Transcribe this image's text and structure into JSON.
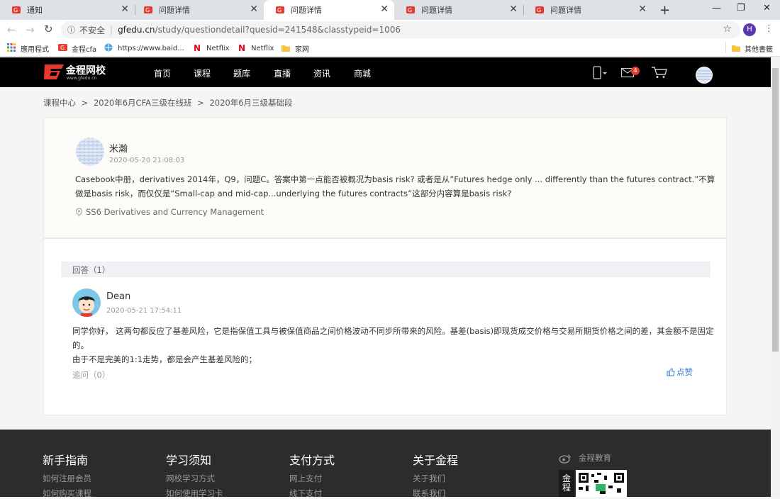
{
  "tabs": [
    {
      "label": "通知"
    },
    {
      "label": "问题详情"
    },
    {
      "label": "问题详情"
    },
    {
      "label": "问题详情"
    },
    {
      "label": "问题详情"
    }
  ],
  "toolbar": {
    "security": "不安全",
    "url_domain": "gfedu.cn",
    "url_path": "/study/questiondetail?quesid=241548&classtypeid=1006",
    "profile_initial": "H"
  },
  "bookmarks": {
    "items": [
      {
        "label": "應用程式"
      },
      {
        "label": "金程cfa"
      },
      {
        "label": "https://www.baid..."
      },
      {
        "label": "Netflix"
      },
      {
        "label": "Netflix"
      },
      {
        "label": "家网"
      }
    ],
    "other": "其他書籤"
  },
  "site": {
    "logo_text": "金程网校",
    "logo_sub": "www.gfedu.cn",
    "nav": [
      "首页",
      "课程",
      "题库",
      "直播",
      "资讯",
      "商城"
    ],
    "mail_badge": "4"
  },
  "breadcrumb": [
    "课程中心",
    "2020年6月CFA三级在线班",
    "2020年6月三级基础段"
  ],
  "question": {
    "author": "米瀚",
    "time": "2020-05-20 21:08:03",
    "line1": "Casebook中册，derivatives 2014年，Q9，问题C。答案中第一点能否被概况为basis risk? 或者是从”Futures hedge only ... differently than the futures contract.”不算",
    "line2": "做是basis risk，而仅仅是“Small-cap and mid-cap...underlying the futures contracts”这部分内容算是basis risk?",
    "tag": "SS6 Derivatives and Currency Management"
  },
  "answers": {
    "header": "回答（1）",
    "author": "Dean",
    "time": "2020-05-21 17:54:11",
    "line1": "同学你好，  这两句都反应了基差风险，它是指保值工具与被保值商品之间价格波动不同步所带来的风险。基差(basis)即现货成交价格与交易所期货价格之间的差，其金额不是固定",
    "line2": "的。",
    "line3": "由于不是完美的1:1走势，都是会产生基差风险的；",
    "followup": "追问（0）",
    "like": "点赞"
  },
  "footer": {
    "cols": [
      {
        "title": "新手指南",
        "links": [
          "如何注册会员",
          "如何购买课程"
        ]
      },
      {
        "title": "学习须知",
        "links": [
          "网校学习方式",
          "如何使用学习卡"
        ]
      },
      {
        "title": "支付方式",
        "links": [
          "网上支付",
          "线下支付"
        ]
      },
      {
        "title": "关于金程",
        "links": [
          "关于我们",
          "联系我们"
        ]
      }
    ],
    "weibo": "金程教育",
    "qr_label": "金程"
  }
}
